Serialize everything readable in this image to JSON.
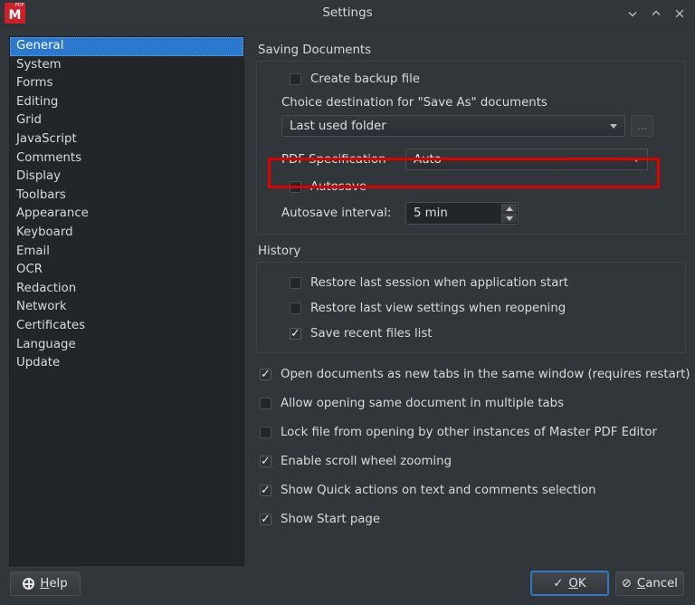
{
  "window": {
    "title": "Settings",
    "app_icon_label": "PDF",
    "app_icon_letter": "M",
    "controls": [
      {
        "name": "minimize",
        "glyph": "chevron-down-icon"
      },
      {
        "name": "maximize",
        "glyph": "chevron-up-icon"
      },
      {
        "name": "close",
        "glyph": "close-icon"
      }
    ]
  },
  "sidebar": {
    "selected": "General",
    "items": [
      {
        "label": "General"
      },
      {
        "label": "System"
      },
      {
        "label": "Forms"
      },
      {
        "label": "Editing"
      },
      {
        "label": "Grid"
      },
      {
        "label": "JavaScript"
      },
      {
        "label": "Comments"
      },
      {
        "label": "Display"
      },
      {
        "label": "Toolbars"
      },
      {
        "label": "Appearance"
      },
      {
        "label": "Keyboard"
      },
      {
        "label": "Email"
      },
      {
        "label": "OCR"
      },
      {
        "label": "Redaction"
      },
      {
        "label": "Network"
      },
      {
        "label": "Certificates"
      },
      {
        "label": "Language"
      },
      {
        "label": "Update"
      }
    ]
  },
  "saving_documents": {
    "group_title": "Saving Documents",
    "create_backup": {
      "label": "Create backup file",
      "checked": false
    },
    "destination_label": "Choice destination for \"Save As\" documents",
    "destination_combo": {
      "value": "Last used folder"
    },
    "browse_button": {
      "label": "...",
      "enabled": false
    },
    "pdf_specification": {
      "label": "PDF Specification",
      "value": "Auto"
    },
    "autosave": {
      "label": "Autosave",
      "checked": false
    },
    "autosave_interval": {
      "label": "Autosave interval:",
      "value": "5 min"
    }
  },
  "history": {
    "group_title": "History",
    "items": [
      {
        "label": "Restore last session when application start",
        "checked": false
      },
      {
        "label": "Restore last view settings when reopening",
        "checked": false
      },
      {
        "label": "Save recent files list",
        "checked": true
      }
    ]
  },
  "options": [
    {
      "label": "Open documents as new tabs in the same window (requires restart)",
      "checked": true
    },
    {
      "label": "Allow opening same document in multiple tabs",
      "checked": false
    },
    {
      "label": "Lock file from opening by other instances of Master PDF Editor",
      "checked": false
    },
    {
      "label": "Enable scroll wheel zooming",
      "checked": true
    },
    {
      "label": "Show Quick actions on text and comments selection",
      "checked": true
    },
    {
      "label": "Show Start page",
      "checked": true
    }
  ],
  "footer": {
    "help": {
      "label": "Help",
      "mnemonic": "H",
      "rest": "elp",
      "icon": "help-ring-icon"
    },
    "ok": {
      "glyph": "✓",
      "mnemonic": "O",
      "rest": "K",
      "focused": true
    },
    "cancel": {
      "glyph": "⊘",
      "mnemonic": "C",
      "rest": "ancel",
      "focused": false
    }
  },
  "annotation": {
    "color": "#e00000",
    "target": "PDF Specification"
  }
}
